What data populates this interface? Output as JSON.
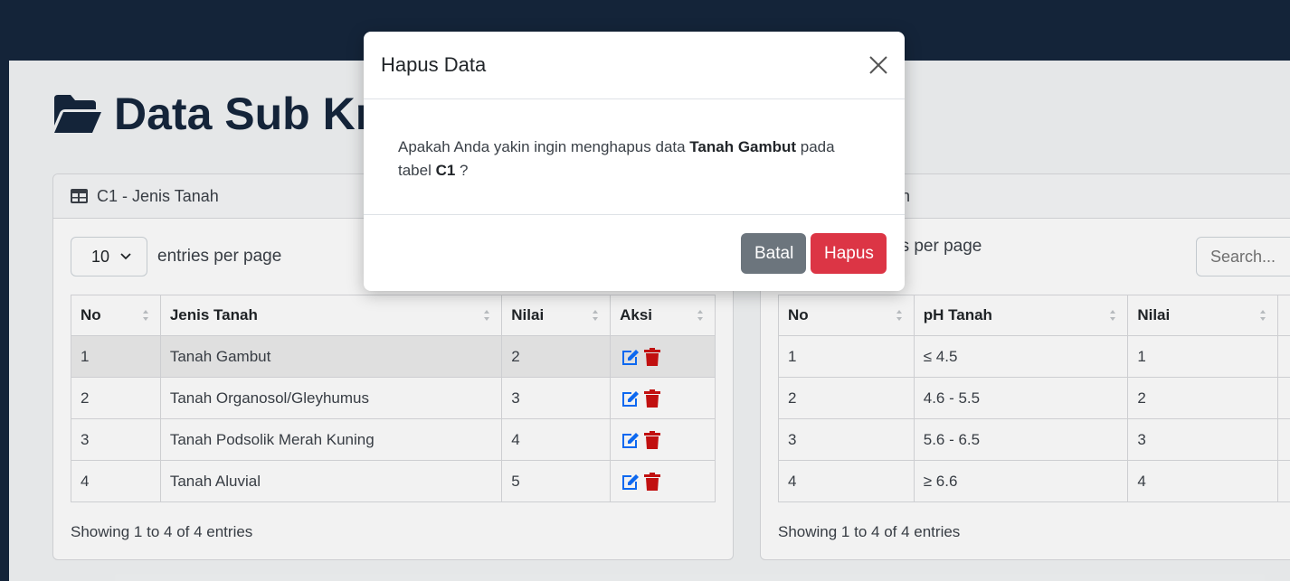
{
  "page": {
    "title": "Data Sub Kriteria"
  },
  "colors": {
    "navy": "#16263d",
    "danger": "#dc3545",
    "secondary": "#6c757d",
    "edit_icon": "#0d6efd",
    "delete_icon": "#cc1111"
  },
  "left_card": {
    "title": "C1 - Jenis Tanah",
    "per_page_value": "10",
    "per_page_label": "entries per page",
    "columns": [
      "No",
      "Jenis Tanah",
      "Nilai",
      "Aksi"
    ],
    "rows": [
      {
        "no": "1",
        "name": "Tanah Gambut",
        "value": "2"
      },
      {
        "no": "2",
        "name": "Tanah Organosol/Gleyhumus",
        "value": "3"
      },
      {
        "no": "3",
        "name": "Tanah Podsolik Merah Kuning",
        "value": "4"
      },
      {
        "no": "4",
        "name": "Tanah Aluvial",
        "value": "5"
      }
    ],
    "showing": "Showing 1 to 4 of 4 entries"
  },
  "right_card": {
    "title_fragment": "h",
    "per_page_fragment": "es per page",
    "search_placeholder": "Search...",
    "columns": [
      "No",
      "pH Tanah",
      "Nilai"
    ],
    "rows": [
      {
        "no": "1",
        "name": "≤ 4.5",
        "value": "1"
      },
      {
        "no": "2",
        "name": "4.6 - 5.5",
        "value": "2"
      },
      {
        "no": "3",
        "name": "5.6 - 6.5",
        "value": "3"
      },
      {
        "no": "4",
        "name": "≥ 6.6",
        "value": "4"
      }
    ],
    "showing": "Showing 1 to 4 of 4 entries"
  },
  "modal": {
    "title": "Hapus Data",
    "body_prefix": "Apakah Anda yakin ingin menghapus data ",
    "item": "Tanah Gambut",
    "body_middle": " pada tabel ",
    "table": "C1",
    "body_suffix": " ?",
    "cancel_label": "Batal",
    "confirm_label": "Hapus"
  }
}
